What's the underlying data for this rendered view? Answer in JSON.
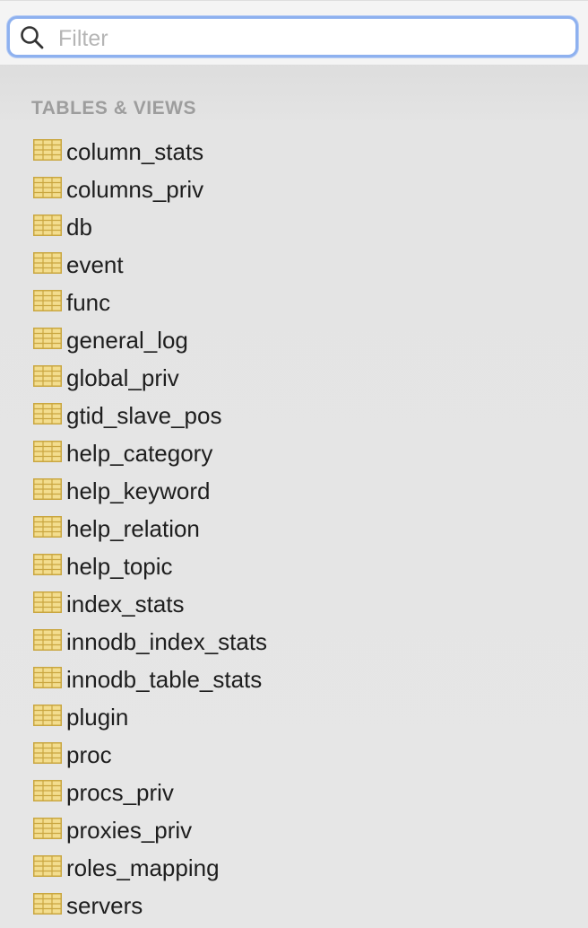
{
  "filter": {
    "placeholder": "Filter",
    "value": "",
    "accent_color": "#8eb1ef"
  },
  "section": {
    "title": "TABLES & VIEWS"
  },
  "tables": [
    {
      "name": "column_stats",
      "icon": "table-icon"
    },
    {
      "name": "columns_priv",
      "icon": "table-icon"
    },
    {
      "name": "db",
      "icon": "table-icon"
    },
    {
      "name": "event",
      "icon": "table-icon"
    },
    {
      "name": "func",
      "icon": "table-icon"
    },
    {
      "name": "general_log",
      "icon": "table-icon"
    },
    {
      "name": "global_priv",
      "icon": "table-icon"
    },
    {
      "name": "gtid_slave_pos",
      "icon": "table-icon"
    },
    {
      "name": "help_category",
      "icon": "table-icon"
    },
    {
      "name": "help_keyword",
      "icon": "table-icon"
    },
    {
      "name": "help_relation",
      "icon": "table-icon"
    },
    {
      "name": "help_topic",
      "icon": "table-icon"
    },
    {
      "name": "index_stats",
      "icon": "table-icon"
    },
    {
      "name": "innodb_index_stats",
      "icon": "table-icon"
    },
    {
      "name": "innodb_table_stats",
      "icon": "table-icon"
    },
    {
      "name": "plugin",
      "icon": "table-icon"
    },
    {
      "name": "proc",
      "icon": "table-icon"
    },
    {
      "name": "procs_priv",
      "icon": "table-icon"
    },
    {
      "name": "proxies_priv",
      "icon": "table-icon"
    },
    {
      "name": "roles_mapping",
      "icon": "table-icon"
    },
    {
      "name": "servers",
      "icon": "table-icon"
    }
  ],
  "colors": {
    "table_icon_fill": "#f3dd8e",
    "table_icon_line": "#c9a640"
  }
}
